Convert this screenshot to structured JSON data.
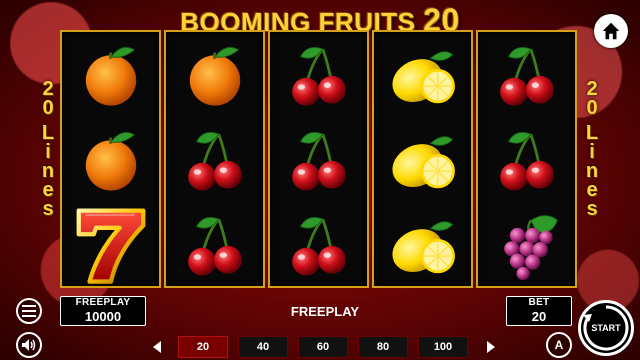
{
  "game": {
    "title_text": "BOOMING FRUITS",
    "title_number": "20",
    "lines_label": [
      "2",
      "0",
      "L",
      "i",
      "n",
      "e",
      "s"
    ]
  },
  "reels": [
    [
      "orange",
      "orange",
      "seven"
    ],
    [
      "orange",
      "cherry",
      "cherry"
    ],
    [
      "cherry",
      "cherry",
      "cherry"
    ],
    [
      "lemon",
      "lemon",
      "lemon"
    ],
    [
      "cherry",
      "cherry",
      "grapes"
    ]
  ],
  "hud": {
    "freeplay_label": "FREEPLAY",
    "freeplay_value": "10000",
    "status_text": "FREEPLAY",
    "bet_label": "BET",
    "bet_value": "20",
    "start_label": "START",
    "auto_label": "A"
  },
  "bet_options": [
    {
      "value": "20",
      "selected": true
    },
    {
      "value": "40",
      "selected": false
    },
    {
      "value": "60",
      "selected": false
    },
    {
      "value": "80",
      "selected": false
    },
    {
      "value": "100",
      "selected": false
    }
  ],
  "icons": {
    "home": "home-icon",
    "menu": "menu-icon",
    "sound": "speaker-icon",
    "auto": "autoplay-icon",
    "start": "start-icon",
    "prev": "arrow-left-icon",
    "next": "arrow-right-icon"
  },
  "colors": {
    "gold": "#ffd23a",
    "reel_border": "#d4a017",
    "background": "#7a0606",
    "selected_bet": "#7a0000"
  }
}
